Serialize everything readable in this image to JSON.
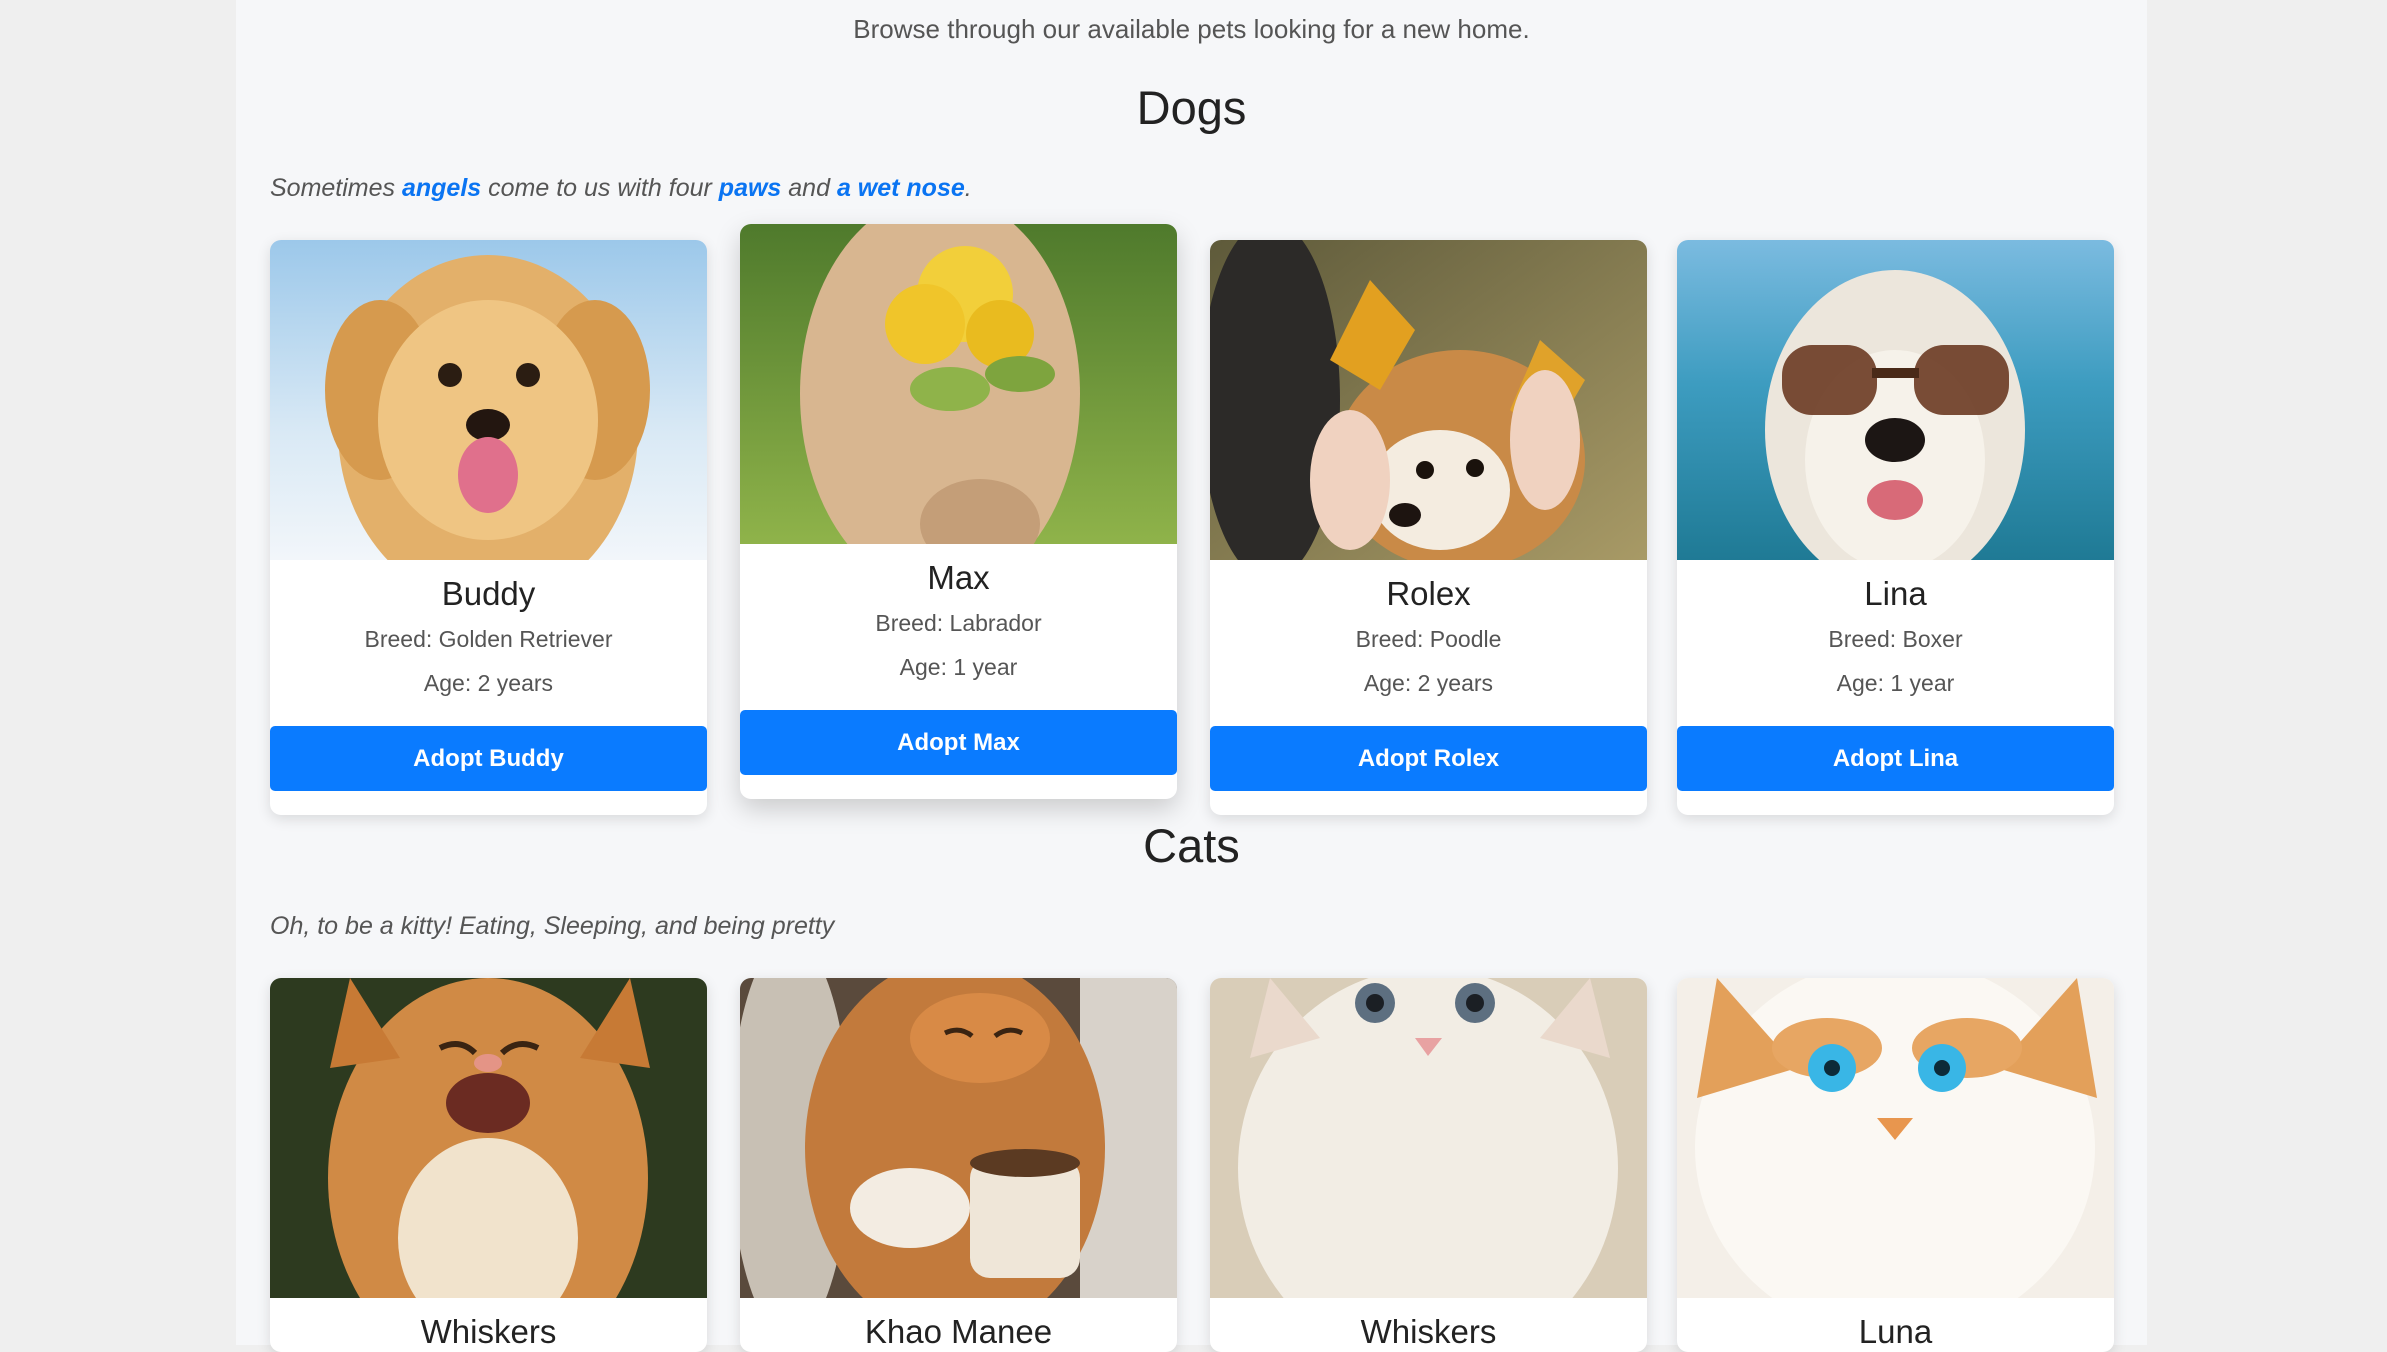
{
  "intro": "Browse through our available pets looking for a new home.",
  "dogs": {
    "title": "Dogs",
    "tagline": {
      "p1": "Sometimes ",
      "h1": "angels",
      "p2": " come to us with four ",
      "h2": "paws",
      "p3": " and ",
      "h3": "a wet nose",
      "p4": "."
    },
    "pets": [
      {
        "name": "Buddy",
        "breed": "Breed: Golden Retriever",
        "age": "Age: 2 years",
        "button": "Adopt Buddy"
      },
      {
        "name": "Max",
        "breed": "Breed: Labrador",
        "age": "Age: 1 year",
        "button": "Adopt Max"
      },
      {
        "name": "Rolex",
        "breed": "Breed: Poodle",
        "age": "Age: 2 years",
        "button": "Adopt Rolex"
      },
      {
        "name": "Lina",
        "breed": "Breed: Boxer",
        "age": "Age: 1 year",
        "button": "Adopt Lina"
      }
    ]
  },
  "cats": {
    "title": "Cats",
    "tagline": "Oh, to be a kitty! Eating, Sleeping, and being pretty",
    "pets": [
      {
        "name": "Whiskers"
      },
      {
        "name": "Khao Manee"
      },
      {
        "name": "Whiskers"
      },
      {
        "name": "Luna"
      }
    ]
  },
  "colors": {
    "accent": "#0a7bff",
    "link": "#0a74f2",
    "page_bg": "#f6f7f9"
  }
}
